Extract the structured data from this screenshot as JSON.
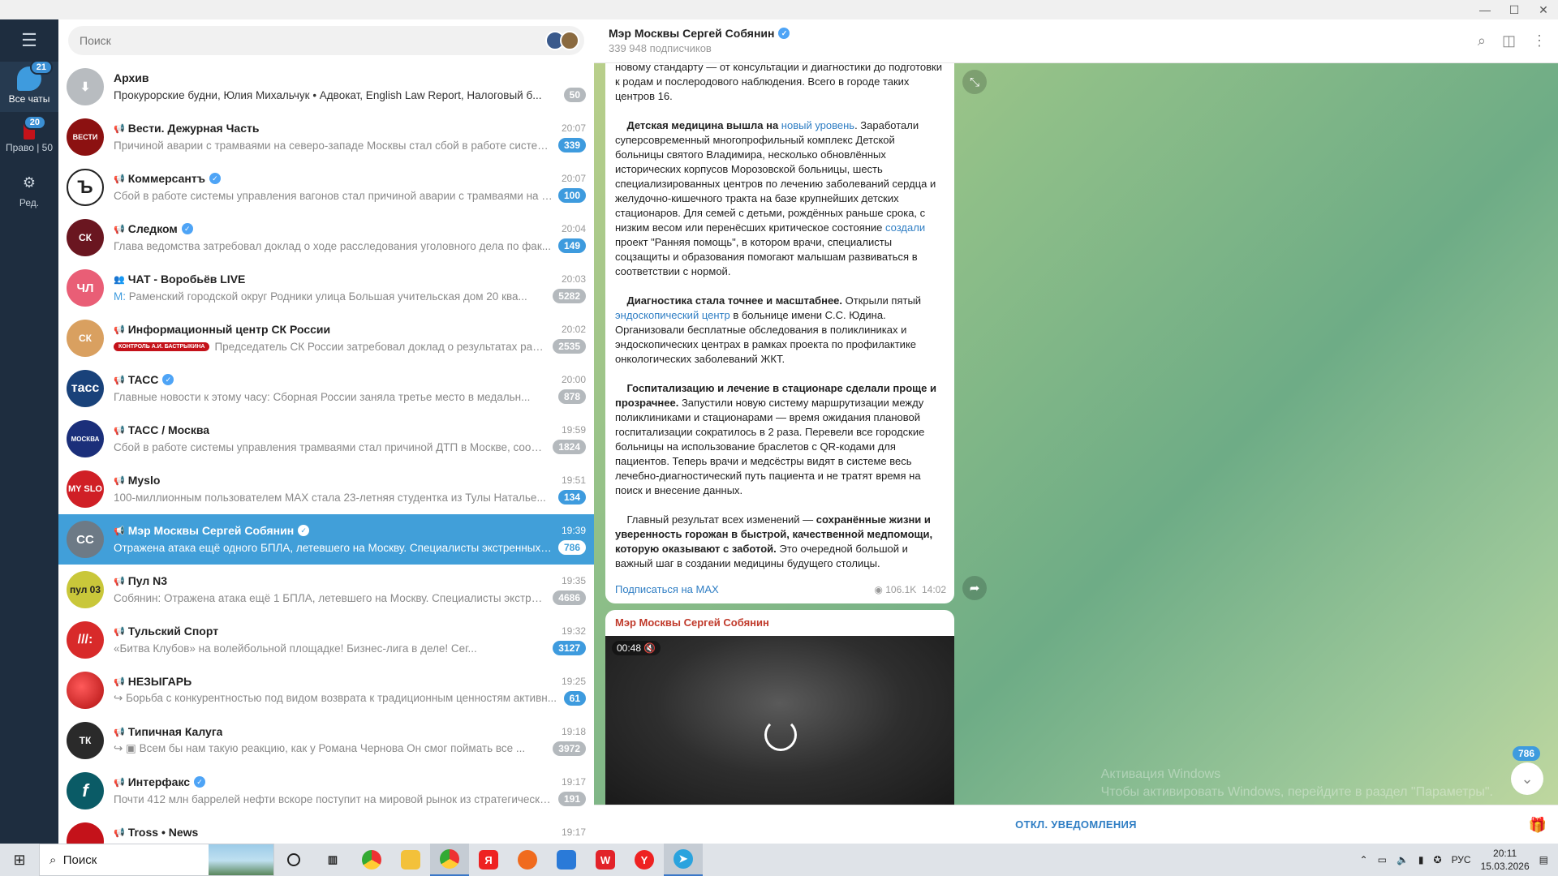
{
  "window": {
    "controls": [
      "—",
      "☐",
      "✕"
    ]
  },
  "rail": {
    "items": [
      {
        "label": "Все чаты",
        "badge": "21"
      },
      {
        "label": "Право | 50",
        "badge": "20"
      },
      {
        "label": "Ред."
      }
    ]
  },
  "search": {
    "placeholder": "Поиск"
  },
  "chats": [
    {
      "name": "Архив",
      "time": "",
      "preview": "Прокурорские будни, Юлия Михальчук • Адвокат, English Law Report, Налоговый б...",
      "badge": "50",
      "avatar": "",
      "color": "#b8bcc0"
    },
    {
      "name": "Вести. Дежурная Часть",
      "time": "20:07",
      "preview": "Причиной аварии с трамваями на северо-западе Москвы стал сбой в работе системы ...",
      "badge": "339",
      "avatar": "ВЕСТИ",
      "color": "#8c1111"
    },
    {
      "name": "Коммерсантъ",
      "time": "20:07",
      "preview": "Сбой в работе системы управления вагонов стал причиной аварии с трамваями на се...",
      "badge": "100",
      "avatar": "Ъ",
      "color": "#ffffff"
    },
    {
      "name": "Следком",
      "time": "20:04",
      "preview": "Глава ведомства затребовал доклад о ходе расследования уголовного дела по фак...",
      "badge": "149",
      "avatar": "СК",
      "color": "#6a1620"
    },
    {
      "name": "ЧАТ - Воробьёв LIVE",
      "time": "20:03",
      "preview_prefix": "М:",
      "preview": "Раменский городской округ Родники улица Большая учительская дом 20 ква...",
      "badge": "5282",
      "avatar": "ЧЛ",
      "color": "#e95e76"
    },
    {
      "name": "Информационный центр СК России",
      "time": "20:02",
      "tag": "КОНТРОЛЬ А.И. БАСТРЫКИНА",
      "preview": "Председатель СК России затребовал доклад о результатах расследован...",
      "badge": "2535",
      "avatar": "СК",
      "color": "#d9a060"
    },
    {
      "name": "ТАСС",
      "time": "20:00",
      "preview": "Главные новости к этому часу:      Сборная России заняла третье место в медальн...",
      "badge": "878",
      "avatar": "тасс",
      "color": "#19427a"
    },
    {
      "name": "ТАСС / Москва",
      "time": "19:59",
      "preview": "Сбой в работе системы управления трамваями стал причиной ДТП в Москве, сообщ...",
      "badge": "1824",
      "avatar": "МОСКВА",
      "color": "#1b2f7a"
    },
    {
      "name": "Myslo",
      "time": "19:51",
      "preview": "100-миллионным пользователем MAX стала 23-летняя студентка из Тулы  Наталье...",
      "badge": "134",
      "avatar": "MY SLO",
      "color": "#d01f26"
    },
    {
      "name": "Мэр Москвы Сергей Собянин",
      "time": "19:39",
      "preview": "Отражена атака ещё одного БПЛА, летевшего на Москву. Специалисты экстренных сл...",
      "badge": "786",
      "avatar": "СС",
      "color": "#6d7a86"
    },
    {
      "name": "Пул N3",
      "time": "19:35",
      "preview_prefix": "Собянин:",
      "preview": "Отражена атака ещё 1 БПЛА, летевшего на Москву. Специалисты экстренн...",
      "badge": "4686",
      "avatar": "пул 03",
      "color": "#c9c73a"
    },
    {
      "name": "Тульский Спорт",
      "time": "19:32",
      "preview": "«Битва Клубов» на волейбольной площадке! Бизнес-лига в деле!  Сег...",
      "badge": "3127",
      "avatar": "///:",
      "color": "#d82a2a"
    },
    {
      "name": "НЕЗЫГАРЬ",
      "time": "19:25",
      "preview": "Борьба с конкурентностью под видом возврата к традиционным ценностям активн...",
      "badge": "61",
      "avatar": "",
      "color": "#d8262b"
    },
    {
      "name": "Типичная Калуга",
      "time": "19:18",
      "preview": "Всем бы нам такую реакцию, как у Романа Чернова  Он смог поймать все ...",
      "badge": "3972",
      "avatar": "ТК",
      "color": "#2a2a2a"
    },
    {
      "name": "Интерфакс",
      "time": "19:17",
      "preview": "Почти 412 млн баррелей нефти вскоре поступит на мировой рынок из стратегически...",
      "badge": "191",
      "avatar": "f",
      "color": "#0a5b66"
    },
    {
      "name": "Tross • News",
      "time": "19:17",
      "preview": "",
      "badge": "",
      "avatar": "",
      "color": "#c4121a"
    }
  ],
  "chat": {
    "title": "Мэр Москвы Сергей Собянин",
    "subscribers": "339 948 подписчиков",
    "message": {
      "p1": "новому стандарту — от консультации и диагностики до подготовки к родам и послеродового наблюдения. Всего в городе таких центров 16.",
      "p2_bold": "Детская медицина вышла на ",
      "p2_link": "новый уровень",
      "p2_rest": ". Заработали суперсовременный многопрофильный комплекс Детской больницы святого Владимира, несколько обновлённых исторических корпусов Морозовской больницы, шесть специализированных центров по лечению заболеваний сердца и желудочно-кишечного тракта на базе крупнейших детских стационаров. Для семей с детьми, рождённых раньше срока, с низким весом или перенёсших критическое состояние ",
      "p2_link2": "создали",
      "p2_end": " проект \"Ранняя помощь\", в котором врачи, специалисты соцзащиты и образования помогают малышам развиваться в соответствии с нормой.",
      "p3_bold": "Диагностика стала точнее и масштабнее.",
      "p3_rest": " Открыли пятый ",
      "p3_link": "эндоскопический центр",
      "p3_end": " в больнице имени С.С. Юдина. Организовали бесплатные обследования в поликлиниках и эндоскопических центрах в рамках проекта по профилактике онкологических заболеваний ЖКТ.",
      "p4_bold": "Госпитализацию и лечение в стационаре сделали проще и прозрачнее.",
      "p4_rest": " Запустили новую систему маршрутизации между поликлиниками и стационарами — время ожидания плановой госпитализации сократилось в 2 раза. Перевели все городские больницы на использование браслетов с QR-кодами для пациентов. Теперь врачи и медсёстры видят в системе весь лечебно-диагностический путь пациента и не тратят время на поиск и внесение данных.",
      "p5_start": "Главный результат всех изменений — ",
      "p5_bold": "сохранённые жизни и уверенность горожан в быстрой, качественной медпомощи, которую оказывают с заботой.",
      "p5_end": " Это очередной большой и важный шаг в создании медицины будущего столицы.",
      "subscribe_link": "Подписаться на MAX",
      "views": "106.1K",
      "time": "14:02"
    },
    "video": {
      "author": "Мэр Москвы Сергей Собянин",
      "duration": "00:48"
    },
    "unread_badge": "786",
    "watermark_line1": "Активация Windows",
    "watermark_line2": "Чтобы активировать Windows, перейдите в раздел \"Параметры\".",
    "mute_button": "ОТКЛ. УВЕДОМЛЕНИЯ"
  },
  "taskbar": {
    "search_label": "Поиск",
    "lang": "РУС",
    "time": "20:11",
    "date": "15.03.2026"
  }
}
